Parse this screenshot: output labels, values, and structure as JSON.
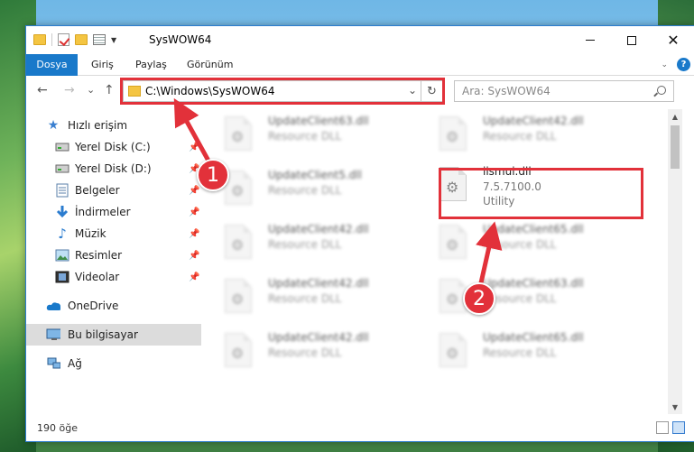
{
  "window": {
    "title": "SysWOW64",
    "minimize_symbol": "",
    "close_symbol": "✕"
  },
  "ribbon": {
    "tabs": [
      {
        "label": "Dosya"
      },
      {
        "label": "Giriş"
      },
      {
        "label": "Paylaş"
      },
      {
        "label": "Görünüm"
      }
    ],
    "help": "?"
  },
  "navigation": {
    "back": "←",
    "forward": "→",
    "recent": "⌄",
    "up": "↑"
  },
  "address": {
    "path": "C:\\Windows\\SysWOW64",
    "dropdown": "⌄",
    "refresh": "↻"
  },
  "search": {
    "placeholder": "Ara: SysWOW64"
  },
  "sidebar": {
    "items": [
      {
        "label": "Hızlı erişim",
        "icon": "star-icon"
      },
      {
        "label": "Yerel Disk (C:)",
        "icon": "drive-icon"
      },
      {
        "label": "Yerel Disk (D:)",
        "icon": "drive-icon"
      },
      {
        "label": "Belgeler",
        "icon": "documents-icon"
      },
      {
        "label": "İndirmeler",
        "icon": "download-icon"
      },
      {
        "label": "Müzik",
        "icon": "music-icon"
      },
      {
        "label": "Resimler",
        "icon": "pictures-icon"
      },
      {
        "label": "Videolar",
        "icon": "video-icon"
      },
      {
        "label": "OneDrive",
        "icon": "cloud-icon"
      },
      {
        "label": "Bu bilgisayar",
        "icon": "computer-icon"
      },
      {
        "label": "Ağ",
        "icon": "network-icon"
      }
    ],
    "pin": "📌"
  },
  "files": [
    {
      "name": "UpdateClient63.dll",
      "line2": "Resource DLL",
      "line3": ""
    },
    {
      "name": "UpdateClient42.dll",
      "line2": "Resource DLL",
      "line3": ""
    },
    {
      "name": "UpdateClient5.dll",
      "line2": "Resource DLL",
      "line3": ""
    },
    {
      "name": "iismui.dll",
      "line2": "7.5.7100.0",
      "line3": "Utility"
    },
    {
      "name": "UpdateClient42.dll",
      "line2": "Resource DLL",
      "line3": ""
    },
    {
      "name": "UpdateClient65.dll",
      "line2": "Resource DLL",
      "line3": ""
    },
    {
      "name": "UpdateClient42.dll",
      "line2": "Resource DLL",
      "line3": ""
    },
    {
      "name": "UpdateClient63.dll",
      "line2": "Resource DLL",
      "line3": ""
    },
    {
      "name": "UpdateClient42.dll",
      "line2": "Resource DLL",
      "line3": ""
    },
    {
      "name": "UpdateClient65.dll",
      "line2": "Resource DLL",
      "line3": ""
    }
  ],
  "status": {
    "count": "190 öğe"
  },
  "callouts": {
    "one": "1",
    "two": "2"
  },
  "colors": {
    "accent": "#1979ca",
    "highlight": "#e2313a"
  }
}
